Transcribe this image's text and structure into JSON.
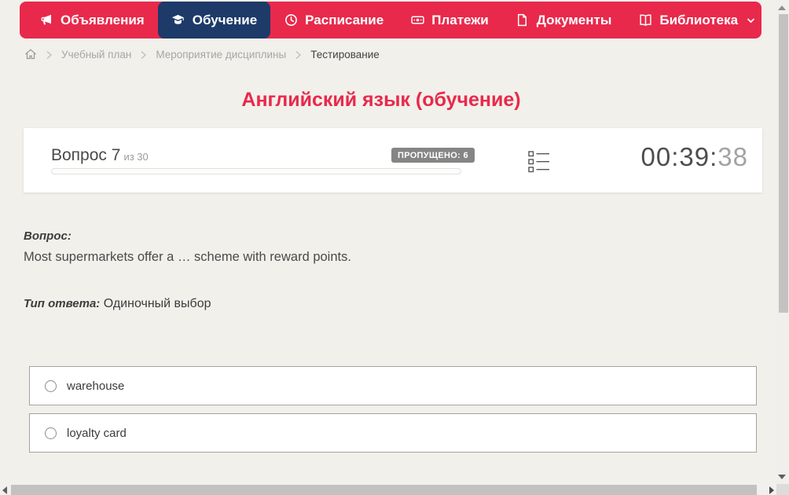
{
  "colors": {
    "accent_red": "#e8294b",
    "active_navy": "#1d3a69",
    "page_bg": "#f2f0eb",
    "badge_gray": "#858585"
  },
  "nav": {
    "items": [
      {
        "label": "Объявления",
        "icon": "megaphone-icon",
        "active": false
      },
      {
        "label": "Обучение",
        "icon": "graduation-cap-icon",
        "active": true
      },
      {
        "label": "Расписание",
        "icon": "clock-icon",
        "active": false
      },
      {
        "label": "Платежи",
        "icon": "banknote-icon",
        "active": false
      },
      {
        "label": "Документы",
        "icon": "document-icon",
        "active": false
      },
      {
        "label": "Библиотека",
        "icon": "book-icon",
        "active": false,
        "has_dropdown": true
      }
    ]
  },
  "breadcrumb": {
    "home_icon": "home-icon",
    "items": [
      "Учебный план",
      "Мероприятие дисциплины",
      "Тестирование"
    ]
  },
  "page": {
    "title": "Английский язык (обучение)"
  },
  "question_card": {
    "title": "Вопрос 7",
    "subtitle": "из 30",
    "skipped_badge": "ПРОПУЩЕНО: 6",
    "progress_percent": 0,
    "question_list_icon": "question-list-icon",
    "timer": {
      "main": "00:39:",
      "seconds": "38"
    }
  },
  "question": {
    "label": "Вопрос:",
    "text": "Most supermarkets offer a … scheme with reward points.",
    "answer_type_label": "Тип ответа:",
    "answer_type_value": "Одиночный выбор"
  },
  "options": [
    {
      "label": "warehouse",
      "selected": false
    },
    {
      "label": "loyalty card",
      "selected": false
    }
  ]
}
